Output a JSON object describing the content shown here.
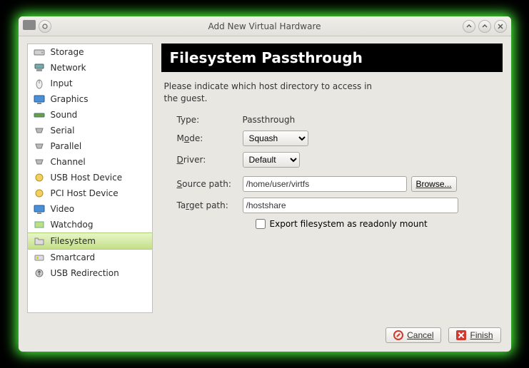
{
  "window": {
    "title": "Add New Virtual Hardware"
  },
  "sidebar": {
    "items": [
      {
        "label": "Storage",
        "icon": "storage"
      },
      {
        "label": "Network",
        "icon": "network"
      },
      {
        "label": "Input",
        "icon": "input"
      },
      {
        "label": "Graphics",
        "icon": "graphics"
      },
      {
        "label": "Sound",
        "icon": "sound"
      },
      {
        "label": "Serial",
        "icon": "serial"
      },
      {
        "label": "Parallel",
        "icon": "parallel"
      },
      {
        "label": "Channel",
        "icon": "channel"
      },
      {
        "label": "USB Host Device",
        "icon": "usb"
      },
      {
        "label": "PCI Host Device",
        "icon": "pci"
      },
      {
        "label": "Video",
        "icon": "video"
      },
      {
        "label": "Watchdog",
        "icon": "watchdog"
      },
      {
        "label": "Filesystem",
        "icon": "filesystem",
        "selected": true
      },
      {
        "label": "Smartcard",
        "icon": "smartcard"
      },
      {
        "label": "USB Redirection",
        "icon": "usbredir"
      }
    ]
  },
  "main": {
    "heading": "Filesystem Passthrough",
    "description": "Please indicate which host directory to access in the guest.",
    "form": {
      "type_label": "Type:",
      "type_value": "Passthrough",
      "mode_label_pre": "M",
      "mode_label_ul": "o",
      "mode_label_post": "de:",
      "mode_value": "Squash",
      "driver_label_pre": "",
      "driver_label_ul": "D",
      "driver_label_post": "river:",
      "driver_value": "Default",
      "source_label_pre": "",
      "source_label_ul": "S",
      "source_label_post": "ource path:",
      "source_value": "/home/user/virtfs",
      "browse_label": "Browse...",
      "target_label_pre": "Ta",
      "target_label_ul": "r",
      "target_label_post": "get path:",
      "target_value": "/hostshare",
      "readonly_label_pre": "",
      "readonly_label_ul": "E",
      "readonly_label_post": "xport filesystem as readonly mount",
      "readonly_checked": false
    }
  },
  "footer": {
    "cancel_label": "Cancel",
    "finish_label": "Finish"
  }
}
